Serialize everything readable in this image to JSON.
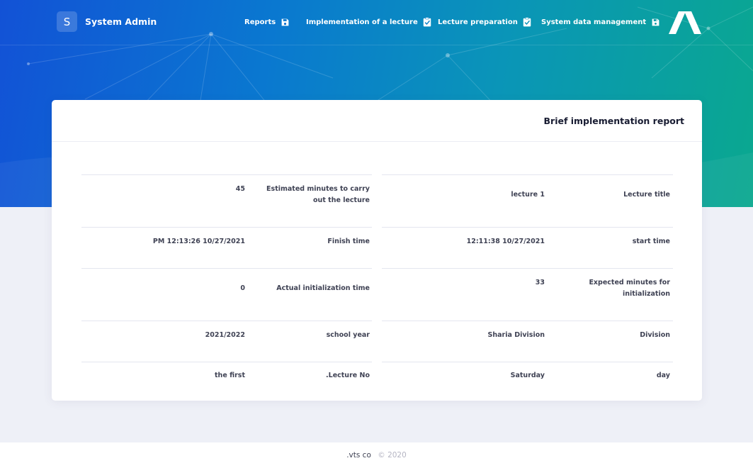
{
  "brand": {
    "initial": "S",
    "name": "System Admin"
  },
  "nav": [
    {
      "label": "Reports",
      "icon": "save-icon"
    },
    {
      "label": "Implementation of a lecture",
      "icon": "clipboard-check-icon"
    },
    {
      "label": "Lecture preparation",
      "icon": "clipboard-check-icon"
    },
    {
      "label": "System data management",
      "icon": "save-icon"
    }
  ],
  "card": {
    "title": "Brief implementation report"
  },
  "report": {
    "rows": [
      {
        "right_label": "Lecture title",
        "right_value": "lecture 1",
        "left_label": "Estimated minutes to carry out the lecture",
        "left_value": "45"
      },
      {
        "right_label": "start time",
        "right_value": "12:11:38 10/27/2021",
        "left_label": "Finish time",
        "left_value": "PM 12:13:26 10/27/2021"
      },
      {
        "right_label": "Expected minutes for initialization",
        "right_value": "33",
        "left_label": "Actual initialization time",
        "left_value": "0"
      },
      {
        "right_label": "Division",
        "right_value": "Sharia Division",
        "left_label": "school year",
        "left_value": "2021/2022"
      },
      {
        "right_label": "day",
        "right_value": "Saturday",
        "left_label": ".Lecture No",
        "left_value": "the first"
      }
    ]
  },
  "footer": {
    "company": ".vts co",
    "copyright": "© 2020"
  },
  "colors": {
    "hero_start": "#1252d6",
    "hero_end": "#0aa88f",
    "page_bg": "#eef0f7"
  }
}
